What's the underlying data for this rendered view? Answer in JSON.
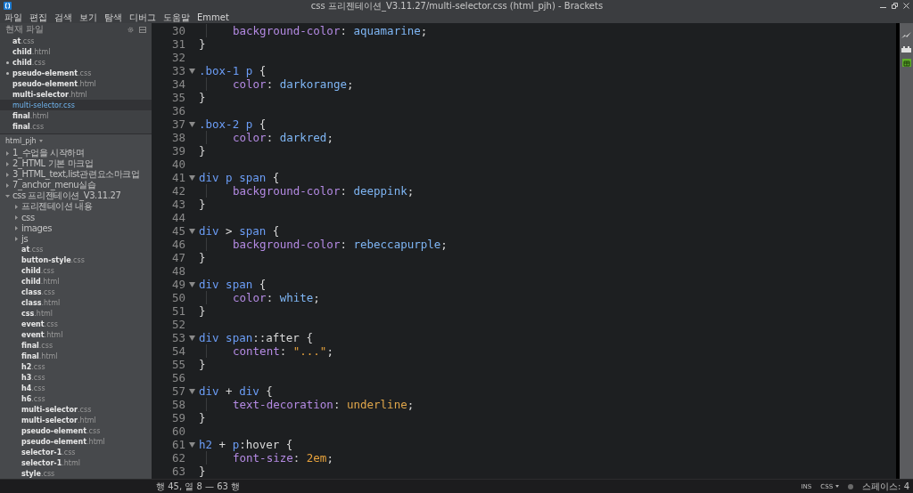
{
  "window": {
    "title": "css 프리젠테이션_V3.11.27/multi-selector.css (html_pjh) - Brackets"
  },
  "menu": [
    "파일",
    "편집",
    "검색",
    "보기",
    "탐색",
    "디버그",
    "도움말",
    "Emmet"
  ],
  "working_files": {
    "title": "현재 파일",
    "files": [
      {
        "name": "at",
        "ext": ".css",
        "dirty": false,
        "selected": false
      },
      {
        "name": "child",
        "ext": ".html",
        "dirty": false,
        "selected": false
      },
      {
        "name": "child",
        "ext": ".css",
        "dirty": true,
        "selected": false
      },
      {
        "name": "pseudo-element",
        "ext": ".css",
        "dirty": true,
        "selected": false
      },
      {
        "name": "pseudo-element",
        "ext": ".html",
        "dirty": false,
        "selected": false
      },
      {
        "name": "multi-selector",
        "ext": ".html",
        "dirty": false,
        "selected": false
      },
      {
        "name": "multi-selector",
        "ext": ".css",
        "dirty": false,
        "selected": true
      },
      {
        "name": "final",
        "ext": ".html",
        "dirty": false,
        "selected": false
      },
      {
        "name": "final",
        "ext": ".css",
        "dirty": false,
        "selected": false
      }
    ]
  },
  "project": {
    "title": "html_pjh",
    "tree": [
      {
        "kind": "folder",
        "name": "1_수업을 시작하며",
        "expanded": false
      },
      {
        "kind": "folder",
        "name": "2_HTML 기본 마크업",
        "expanded": false
      },
      {
        "kind": "folder",
        "name": "3_HTML_text,list관련요소마크업",
        "expanded": false
      },
      {
        "kind": "folder",
        "name": "7_anchor_menu실습",
        "expanded": false
      },
      {
        "kind": "folder",
        "name": "css 프리젠테이션_V3.11.27",
        "expanded": true,
        "children": [
          {
            "kind": "folder",
            "name": "프리젠테이션 내용",
            "expanded": false
          },
          {
            "kind": "folder",
            "name": "css",
            "expanded": false
          },
          {
            "kind": "folder",
            "name": "images",
            "expanded": false
          },
          {
            "kind": "folder",
            "name": "js",
            "expanded": false
          },
          {
            "kind": "file",
            "name": "at",
            "ext": ".css"
          },
          {
            "kind": "file",
            "name": "button-style",
            "ext": ".css"
          },
          {
            "kind": "file",
            "name": "child",
            "ext": ".css"
          },
          {
            "kind": "file",
            "name": "child",
            "ext": ".html"
          },
          {
            "kind": "file",
            "name": "class",
            "ext": ".css"
          },
          {
            "kind": "file",
            "name": "class",
            "ext": ".html"
          },
          {
            "kind": "file",
            "name": "css",
            "ext": ".html"
          },
          {
            "kind": "file",
            "name": "event",
            "ext": ".css"
          },
          {
            "kind": "file",
            "name": "event",
            "ext": ".html"
          },
          {
            "kind": "file",
            "name": "final",
            "ext": ".css"
          },
          {
            "kind": "file",
            "name": "final",
            "ext": ".html"
          },
          {
            "kind": "file",
            "name": "h2",
            "ext": ".css"
          },
          {
            "kind": "file",
            "name": "h3",
            "ext": ".css"
          },
          {
            "kind": "file",
            "name": "h4",
            "ext": ".css"
          },
          {
            "kind": "file",
            "name": "h6",
            "ext": ".css"
          },
          {
            "kind": "file",
            "name": "multi-selector",
            "ext": ".css"
          },
          {
            "kind": "file",
            "name": "multi-selector",
            "ext": ".html"
          },
          {
            "kind": "file",
            "name": "pseudo-element",
            "ext": ".css"
          },
          {
            "kind": "file",
            "name": "pseudo-element",
            "ext": ".html"
          },
          {
            "kind": "file",
            "name": "selector-1",
            "ext": ".css"
          },
          {
            "kind": "file",
            "name": "selector-1",
            "ext": ".html"
          },
          {
            "kind": "file",
            "name": "style",
            "ext": ".css"
          }
        ]
      }
    ]
  },
  "code_lines": [
    {
      "number": "30",
      "foldable": false,
      "indented": true,
      "tokens": [
        {
          "kind": "property",
          "text": "background-color"
        },
        {
          "kind": "punct",
          "text": ": "
        },
        {
          "kind": "keyword",
          "text": "aquamarine"
        },
        {
          "kind": "punct",
          "text": ";"
        }
      ]
    },
    {
      "number": "31",
      "foldable": false,
      "indented": false,
      "tokens": [
        {
          "kind": "punct",
          "text": "}"
        }
      ]
    },
    {
      "number": "32",
      "foldable": false,
      "indented": false
    },
    {
      "number": "33",
      "foldable": true,
      "indented": false,
      "tokens": [
        {
          "kind": "tag",
          "text": ".box-1 p"
        },
        {
          "kind": "punct",
          "text": " {"
        }
      ]
    },
    {
      "number": "34",
      "foldable": false,
      "indented": true,
      "tokens": [
        {
          "kind": "property",
          "text": "color"
        },
        {
          "kind": "punct",
          "text": ": "
        },
        {
          "kind": "keyword",
          "text": "darkorange"
        },
        {
          "kind": "punct",
          "text": ";"
        }
      ]
    },
    {
      "number": "35",
      "foldable": false,
      "indented": false,
      "tokens": [
        {
          "kind": "punct",
          "text": "}"
        }
      ]
    },
    {
      "number": "36",
      "foldable": false,
      "indented": false
    },
    {
      "number": "37",
      "foldable": true,
      "indented": false,
      "tokens": [
        {
          "kind": "tag",
          "text": ".box-2 p"
        },
        {
          "kind": "punct",
          "text": " {"
        }
      ]
    },
    {
      "number": "38",
      "foldable": false,
      "indented": true,
      "tokens": [
        {
          "kind": "property",
          "text": "color"
        },
        {
          "kind": "punct",
          "text": ": "
        },
        {
          "kind": "keyword",
          "text": "darkred"
        },
        {
          "kind": "punct",
          "text": ";"
        }
      ]
    },
    {
      "number": "39",
      "foldable": false,
      "indented": false,
      "tokens": [
        {
          "kind": "punct",
          "text": "}"
        }
      ]
    },
    {
      "number": "40",
      "foldable": false,
      "indented": false
    },
    {
      "number": "41",
      "foldable": true,
      "indented": false,
      "tokens": [
        {
          "kind": "tag",
          "text": "div p span"
        },
        {
          "kind": "punct",
          "text": " {"
        }
      ]
    },
    {
      "number": "42",
      "foldable": false,
      "indented": true,
      "tokens": [
        {
          "kind": "property",
          "text": "background-color"
        },
        {
          "kind": "punct",
          "text": ": "
        },
        {
          "kind": "keyword",
          "text": "deeppink"
        },
        {
          "kind": "punct",
          "text": ";"
        }
      ]
    },
    {
      "number": "43",
      "foldable": false,
      "indented": false,
      "tokens": [
        {
          "kind": "punct",
          "text": "}"
        }
      ]
    },
    {
      "number": "44",
      "foldable": false,
      "indented": false
    },
    {
      "number": "45",
      "foldable": true,
      "indented": false,
      "tokens": [
        {
          "kind": "tag",
          "text": "div"
        },
        {
          "kind": "punct",
          "text": " > "
        },
        {
          "kind": "tag",
          "text": "span"
        },
        {
          "kind": "punct",
          "text": " {"
        }
      ]
    },
    {
      "number": "46",
      "foldable": false,
      "indented": true,
      "tokens": [
        {
          "kind": "property",
          "text": "background-color"
        },
        {
          "kind": "punct",
          "text": ": "
        },
        {
          "kind": "keyword",
          "text": "rebeccapurple"
        },
        {
          "kind": "punct",
          "text": ";"
        }
      ]
    },
    {
      "number": "47",
      "foldable": false,
      "indented": false,
      "tokens": [
        {
          "kind": "punct",
          "text": "}"
        }
      ]
    },
    {
      "number": "48",
      "foldable": false,
      "indented": false
    },
    {
      "number": "49",
      "foldable": true,
      "indented": false,
      "tokens": [
        {
          "kind": "tag",
          "text": "div span"
        },
        {
          "kind": "punct",
          "text": " {"
        }
      ]
    },
    {
      "number": "50",
      "foldable": false,
      "indented": true,
      "tokens": [
        {
          "kind": "property",
          "text": "color"
        },
        {
          "kind": "punct",
          "text": ": "
        },
        {
          "kind": "keyword",
          "text": "white"
        },
        {
          "kind": "punct",
          "text": ";"
        }
      ]
    },
    {
      "number": "51",
      "foldable": false,
      "indented": false,
      "tokens": [
        {
          "kind": "punct",
          "text": "}"
        }
      ]
    },
    {
      "number": "52",
      "foldable": false,
      "indented": false
    },
    {
      "number": "53",
      "foldable": true,
      "indented": false,
      "tokens": [
        {
          "kind": "tag",
          "text": "div span"
        },
        {
          "kind": "punct",
          "text": "::after {"
        }
      ]
    },
    {
      "number": "54",
      "foldable": false,
      "indented": true,
      "tokens": [
        {
          "kind": "property",
          "text": "content"
        },
        {
          "kind": "punct",
          "text": ": "
        },
        {
          "kind": "string",
          "text": "\"...\""
        },
        {
          "kind": "punct",
          "text": ";"
        }
      ]
    },
    {
      "number": "55",
      "foldable": false,
      "indented": false,
      "tokens": [
        {
          "kind": "punct",
          "text": "}"
        }
      ]
    },
    {
      "number": "56",
      "foldable": false,
      "indented": false
    },
    {
      "number": "57",
      "foldable": true,
      "indented": false,
      "tokens": [
        {
          "kind": "tag",
          "text": "div"
        },
        {
          "kind": "punct",
          "text": " + "
        },
        {
          "kind": "tag",
          "text": "div"
        },
        {
          "kind": "punct",
          "text": " {"
        }
      ]
    },
    {
      "number": "58",
      "foldable": false,
      "indented": true,
      "tokens": [
        {
          "kind": "property",
          "text": "text-decoration"
        },
        {
          "kind": "punct",
          "text": ": "
        },
        {
          "kind": "atom",
          "text": "underline"
        },
        {
          "kind": "punct",
          "text": ";"
        }
      ]
    },
    {
      "number": "59",
      "foldable": false,
      "indented": false,
      "tokens": [
        {
          "kind": "punct",
          "text": "}"
        }
      ]
    },
    {
      "number": "60",
      "foldable": false,
      "indented": false
    },
    {
      "number": "61",
      "foldable": true,
      "indented": false,
      "tokens": [
        {
          "kind": "tag",
          "text": "h2"
        },
        {
          "kind": "punct",
          "text": " + "
        },
        {
          "kind": "tag",
          "text": "p"
        },
        {
          "kind": "punct",
          "text": ":hover {"
        }
      ]
    },
    {
      "number": "62",
      "foldable": false,
      "indented": true,
      "tokens": [
        {
          "kind": "property",
          "text": "font-size"
        },
        {
          "kind": "punct",
          "text": ": "
        },
        {
          "kind": "number",
          "text": "2em"
        },
        {
          "kind": "punct",
          "text": ";"
        }
      ]
    },
    {
      "number": "63",
      "foldable": false,
      "indented": false,
      "tokens": [
        {
          "kind": "punct",
          "text": "}"
        }
      ]
    }
  ],
  "status_bar": {
    "position": "행 45, 열 8 — 63 행",
    "mode": "INS",
    "language": "CSS",
    "indent": "스페이스: 4"
  }
}
